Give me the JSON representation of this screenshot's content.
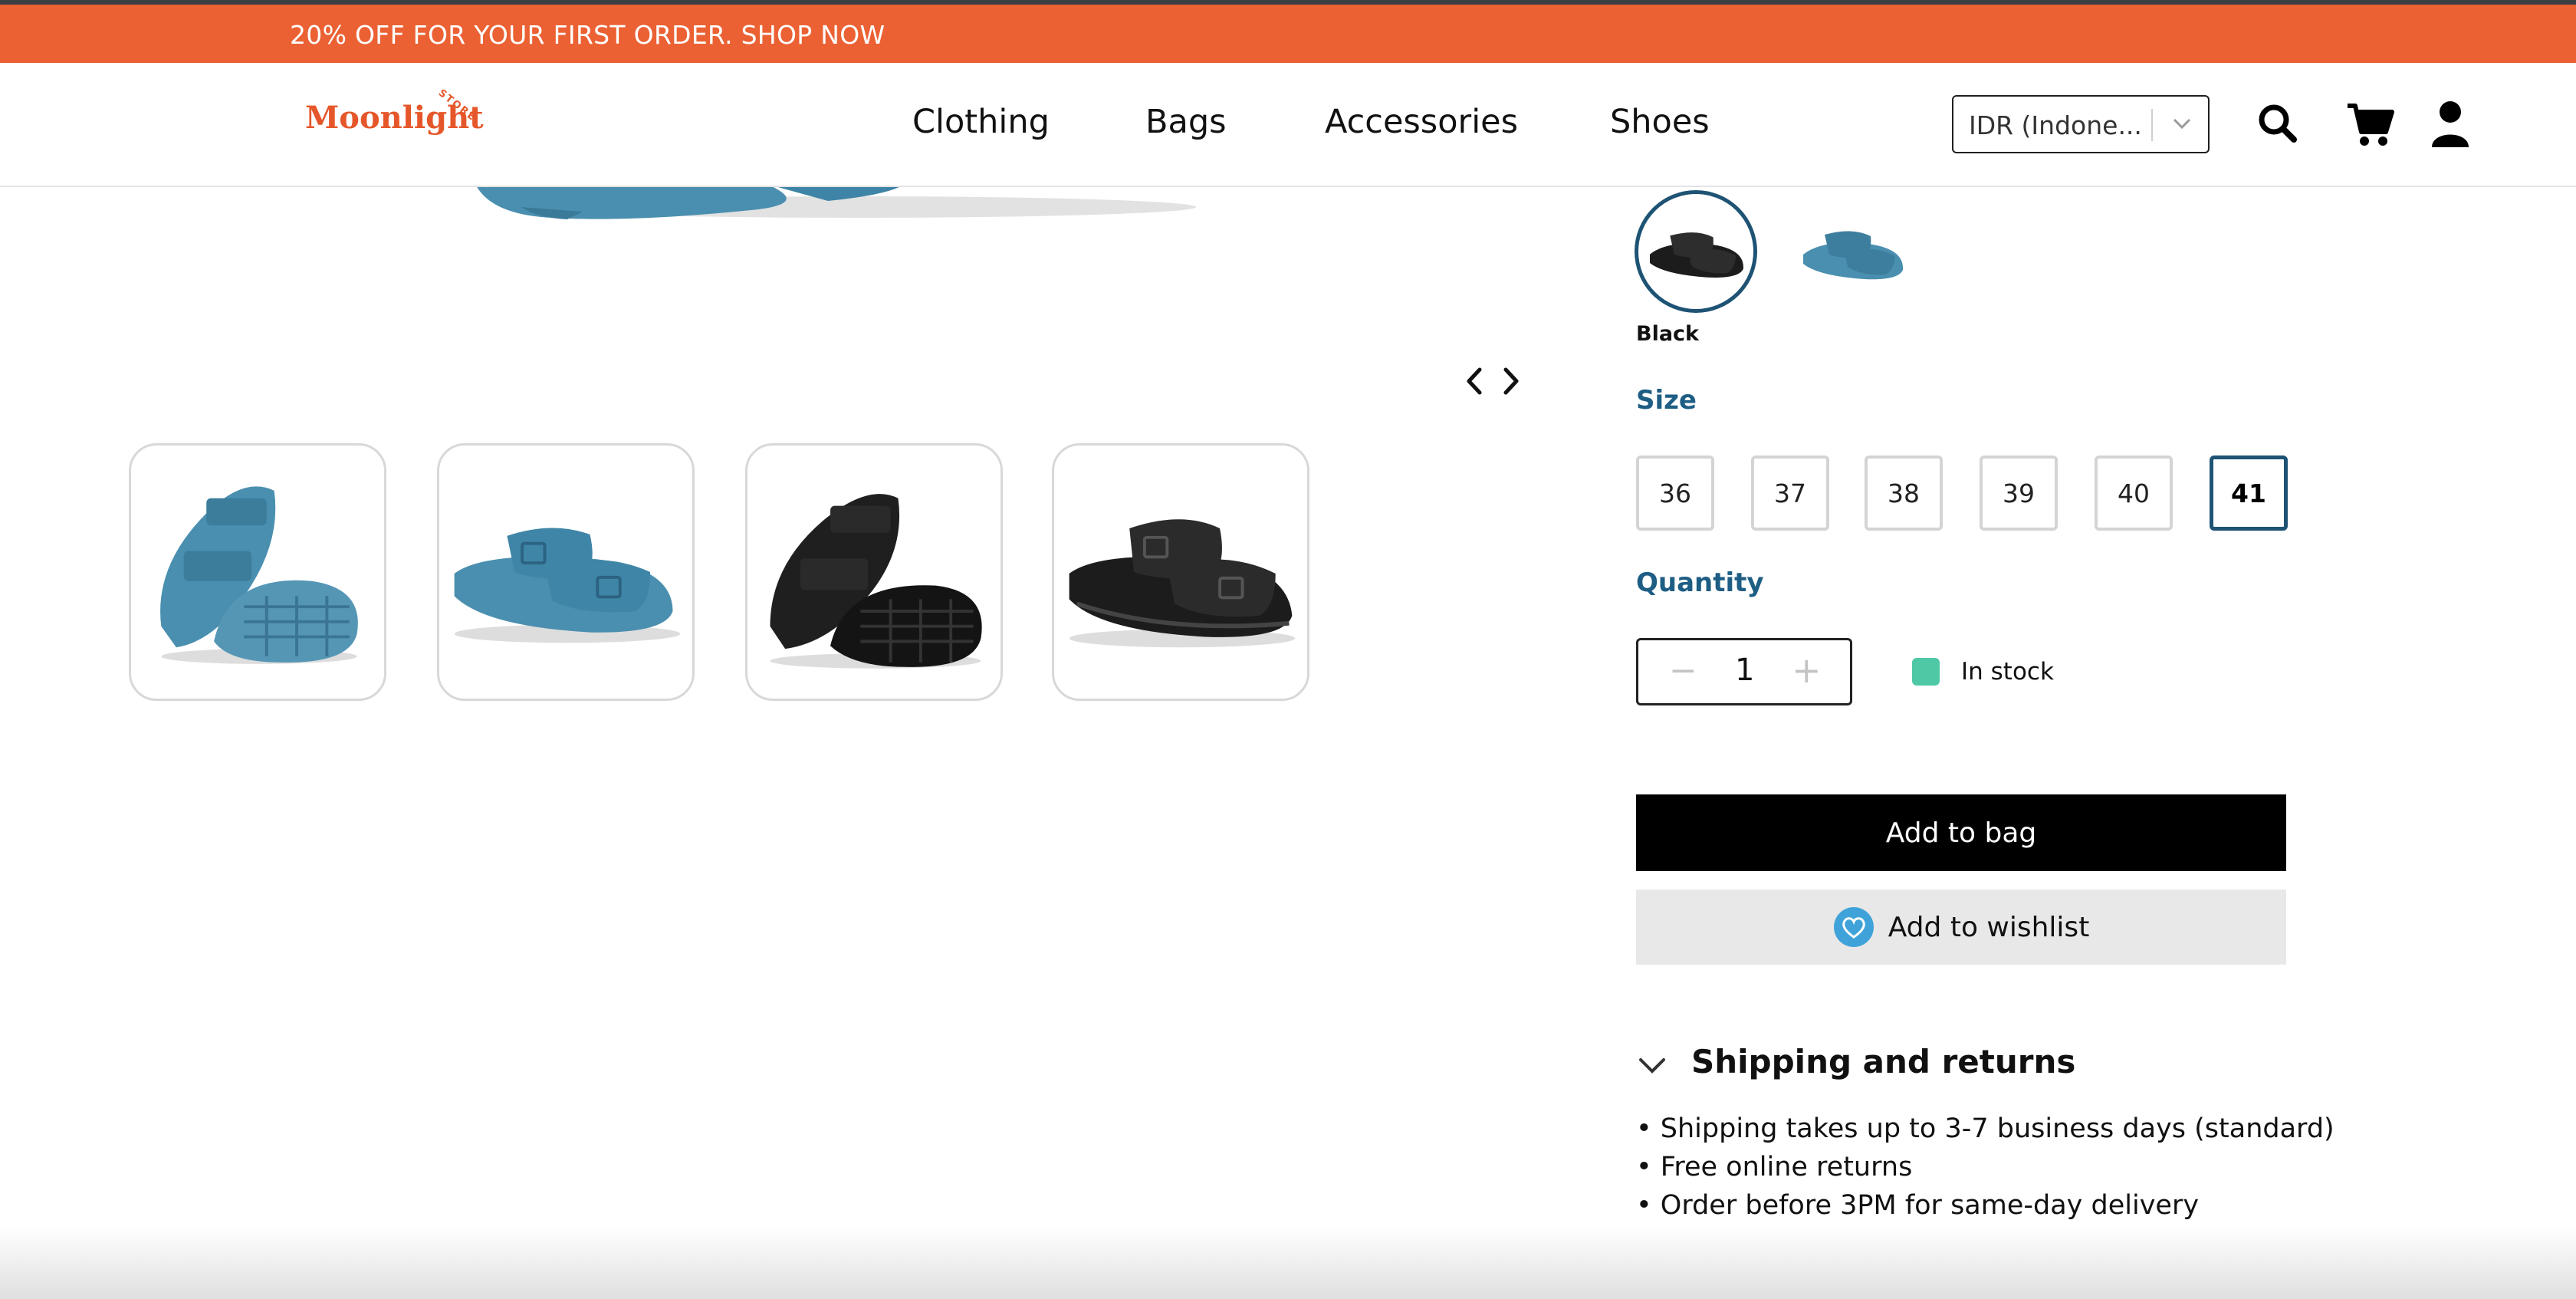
{
  "promo": {
    "text": "20% OFF FOR YOUR FIRST ORDER. SHOP NOW"
  },
  "header": {
    "logo": {
      "main": "Moonlight",
      "sub": "STORE"
    },
    "nav": [
      "Clothing",
      "Bags",
      "Accessories",
      "Shoes"
    ],
    "currency": {
      "value": "IDR (Indone..."
    },
    "icons": [
      "search-icon",
      "cart-icon",
      "user-icon"
    ]
  },
  "gallery": {
    "thumbnails": [
      {
        "name": "blue-sandal-side-sole",
        "color": "#4A8FAF"
      },
      {
        "name": "blue-sandal-top",
        "color": "#4A8FAF"
      },
      {
        "name": "black-sandal-side-sole",
        "color": "#1c1c1c"
      },
      {
        "name": "black-sandal-top",
        "color": "#1c1c1c"
      }
    ]
  },
  "product": {
    "color_selected": "Black",
    "size_label": "Size",
    "sizes": [
      "36",
      "37",
      "38",
      "39",
      "40",
      "41"
    ],
    "size_selected": "41",
    "quantity_label": "Quantity",
    "quantity": "1",
    "minus": "−",
    "plus": "+",
    "stock_text": "In stock",
    "add_to_bag": "Add to bag",
    "add_to_wishlist": "Add to wishlist"
  },
  "shipping": {
    "title": "Shipping and returns",
    "lines": [
      "• Shipping takes up to 3-7 business days (standard)",
      "• Free online returns",
      "• Order before 3PM for same-day delivery"
    ]
  },
  "colors": {
    "promo": "#EB6133",
    "accent": "#1E5D84",
    "stock": "#4FC8A6"
  }
}
